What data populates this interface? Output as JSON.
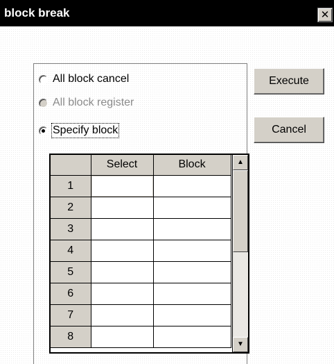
{
  "window": {
    "title": "block break",
    "close_glyph": "✕"
  },
  "options": [
    {
      "label": "All block cancel",
      "checked": false,
      "enabled": true
    },
    {
      "label": "All block register",
      "checked": false,
      "enabled": false
    },
    {
      "label": "Specify block",
      "checked": true,
      "enabled": true
    }
  ],
  "buttons": {
    "execute": "Execute",
    "cancel": "Cancel"
  },
  "table": {
    "columns": [
      "",
      "Select",
      "Block"
    ],
    "rows": [
      {
        "num": "1",
        "select": "",
        "block": ""
      },
      {
        "num": "2",
        "select": "",
        "block": ""
      },
      {
        "num": "3",
        "select": "",
        "block": ""
      },
      {
        "num": "4",
        "select": "",
        "block": ""
      },
      {
        "num": "5",
        "select": "",
        "block": ""
      },
      {
        "num": "6",
        "select": "",
        "block": ""
      },
      {
        "num": "7",
        "select": "",
        "block": ""
      },
      {
        "num": "8",
        "select": "",
        "block": ""
      }
    ]
  },
  "scrollbar": {
    "up_glyph": "▲",
    "down_glyph": "▼"
  },
  "colors": {
    "titlebar": "#000000",
    "face": "#d4d0c8",
    "disabled_text": "#8a8a8a"
  }
}
